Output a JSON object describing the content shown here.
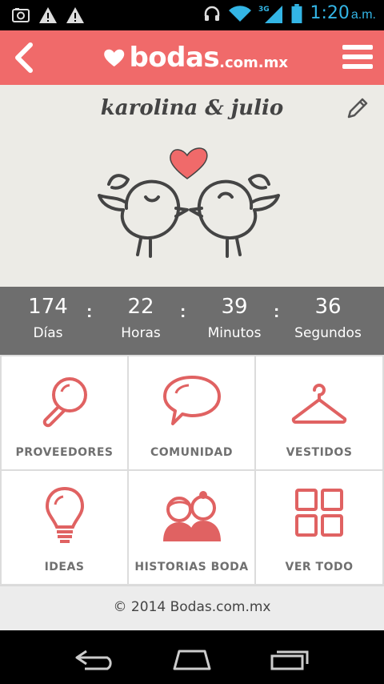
{
  "status_bar": {
    "time": "1:20",
    "ampm": "a.m.",
    "network": "3G",
    "colors": {
      "time": "#33b5e5"
    }
  },
  "app": {
    "brand": "bodas",
    "brand_domain": ".com.mx",
    "accent": "#f06a6a"
  },
  "couple": {
    "names": "karolina & julio"
  },
  "countdown": {
    "units": [
      {
        "value": "174",
        "label": "Días"
      },
      {
        "value": "22",
        "label": "Horas"
      },
      {
        "value": "39",
        "label": "Minutos"
      },
      {
        "value": "36",
        "label": "Segundos"
      }
    ],
    "separator": ":"
  },
  "menu_tiles": [
    {
      "label": "PROVEEDORES",
      "icon": "magnifier-icon"
    },
    {
      "label": "COMUNIDAD",
      "icon": "speech-bubble-icon"
    },
    {
      "label": "VESTIDOS",
      "icon": "hanger-icon"
    },
    {
      "label": "IDEAS",
      "icon": "lightbulb-icon"
    },
    {
      "label": "HISTORIAS BODA",
      "icon": "couple-icon"
    },
    {
      "label": "VER TODO",
      "icon": "grid-icon"
    }
  ],
  "footer": {
    "copyright": "© 2014 Bodas.com.mx"
  }
}
